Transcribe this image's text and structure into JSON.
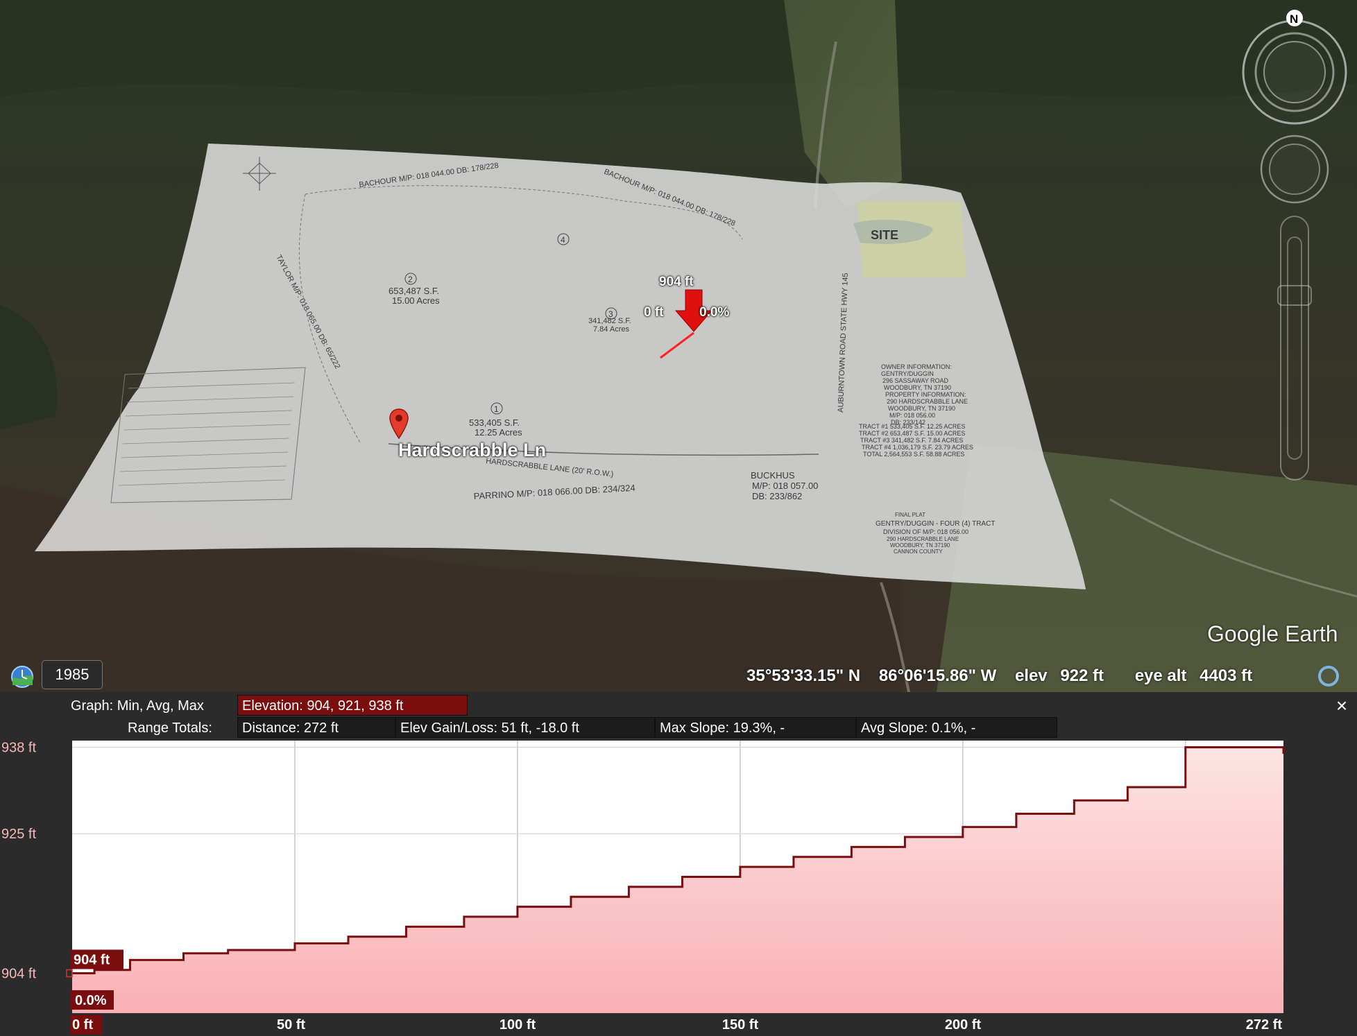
{
  "map": {
    "place_label": "Hardscrabble Ln",
    "ruler": {
      "elevation": "904 ft",
      "distance": "0 ft",
      "slope": "0.0%"
    },
    "logo": "Google Earth",
    "historical_year": "1985",
    "north_label": "N",
    "status": {
      "latitude": "35°53'33.15\" N",
      "longitude": "86°06'15.86\" W",
      "elev_label": "elev",
      "elev_value": "922 ft",
      "eye_alt_label": "eye alt",
      "eye_alt_value": "4403 ft"
    },
    "icons": [
      "time-slider-icon",
      "compass-icon",
      "look-joystick-icon",
      "move-joystick-icon",
      "zoom-slider-icon",
      "placemark-pin-icon",
      "loading-globe-icon",
      "ruler-arrow-icon"
    ]
  },
  "plat": {
    "site_label": "SITE",
    "labels": [
      "BACHOUR M/P: 018 044.00 DB: 178/228",
      "BACHOUR M/P: 018 044.00 DB: 178/228",
      "TAYLOR M/P: 018 065.00 DB: 65/222",
      "AUBURNTOWN ROAD STATE HWY 145",
      "HARDSCRABBLE LANE (20' R.O.W.)",
      "PARRINO M/P: 018 066.00 DB: 234/324",
      "BUCKHUS",
      "M/P: 018 057.00",
      "DB: 233/862",
      "FINAL PLAT",
      "GENTRY/DUGGIN - FOUR (4) TRACT",
      "DIVISION OF M/P: 018 056.00",
      "290 HARDSCRABBLE LANE",
      "WOODBURY, TN 37190",
      "CANNON COUNTY"
    ],
    "tracts": [
      {
        "num": "1",
        "sf": "533,405 S.F.",
        "acres": "12.25 Acres"
      },
      {
        "num": "2",
        "sf": "653,487 S.F.",
        "acres": "15.00 Acres"
      },
      {
        "num": "3",
        "sf": "341,482 S.F.",
        "acres": "7.84 Acres"
      },
      {
        "num": "4",
        "sf": "",
        "acres": ""
      }
    ],
    "owner_info": [
      "OWNER INFORMATION:",
      "GENTRY/DUGGIN",
      "296 SASSAWAY ROAD",
      "WOODBURY, TN 37190",
      "PROPERTY INFORMATION:",
      "290 HARDSCRABBLE LANE",
      "WOODBURY, TN 37190",
      "M/P: 018 056.00",
      "DB: 233/142"
    ],
    "tract_table": [
      "TRACT #1   533,405 S.F.   12.25 ACRES",
      "TRACT #2   653,487 S.F.   15.00 ACRES",
      "TRACT #3   341,482 S.F.   7.84 ACRES",
      "TRACT #4 1,036,179 S.F.  23.79 ACRES",
      "TOTAL      2,564,553 S.F. 58.88 ACRES"
    ]
  },
  "panel": {
    "graph_label": "Graph: Min, Avg, Max",
    "elevation": "Elevation: 904, 921, 938 ft",
    "range_label": "Range Totals:",
    "distance": "Distance: 272 ft",
    "gain_loss": "Elev Gain/Loss: 51 ft, -18.0 ft",
    "max_slope": "Max Slope: 19.3%, -",
    "avg_slope": "Avg Slope: 0.1%, -",
    "close_label": "×"
  },
  "chart_data": {
    "type": "area",
    "xlabel": "",
    "ylabel": "",
    "x_ticks": [
      "0 ft",
      "50 ft",
      "100 ft",
      "150 ft",
      "200 ft",
      "272 ft"
    ],
    "x_tick_values": [
      0,
      50,
      100,
      150,
      200,
      272
    ],
    "y_ticks": [
      "938 ft",
      "925 ft",
      "904 ft"
    ],
    "y_tick_values": [
      938,
      925,
      904
    ],
    "xlim": [
      0,
      272
    ],
    "ylim": [
      898,
      939
    ],
    "grid": true,
    "series": [
      {
        "x": [
          0,
          5,
          13,
          25,
          35,
          50,
          62,
          75,
          88,
          100,
          112,
          125,
          137,
          150,
          162,
          175,
          187,
          200,
          212,
          225,
          237,
          250,
          260,
          272
        ],
        "values": [
          904,
          904.5,
          906,
          907,
          907.5,
          908.5,
          909.5,
          911,
          912.5,
          914,
          915.5,
          917,
          918.5,
          920,
          921.5,
          923,
          924.5,
          926,
          928,
          930,
          932,
          938,
          938,
          937
        ]
      }
    ],
    "cursor_tags": {
      "elevation": "904 ft",
      "slope": "0.0%",
      "distance": "0 ft"
    }
  }
}
